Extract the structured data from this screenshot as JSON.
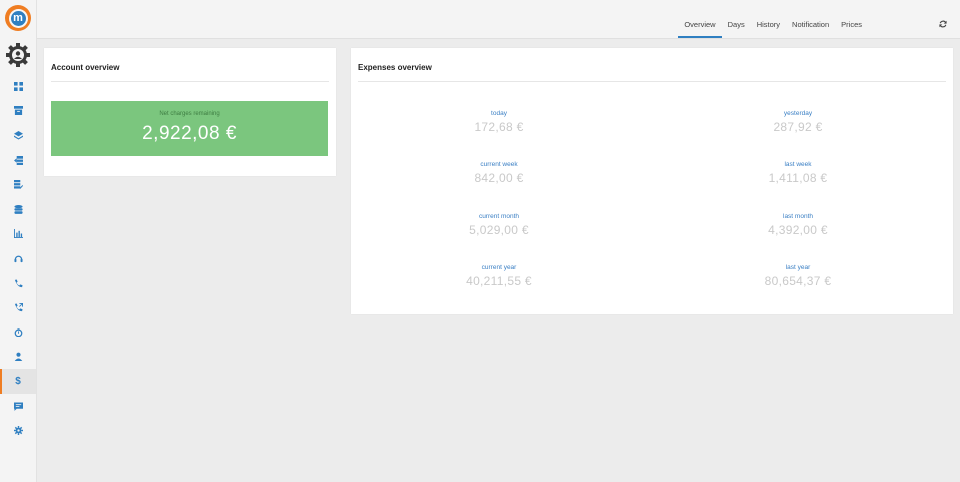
{
  "header": {
    "tabs": [
      {
        "label": "Overview",
        "active": true
      },
      {
        "label": "Days",
        "active": false
      },
      {
        "label": "History",
        "active": false
      },
      {
        "label": "Notification",
        "active": false
      },
      {
        "label": "Prices",
        "active": false
      }
    ],
    "refresh_icon": "refresh-icon"
  },
  "sidebar": {
    "logo_letter": "m",
    "items": [
      {
        "icon": "dashboard-icon"
      },
      {
        "icon": "archive-icon"
      },
      {
        "icon": "layers-icon"
      },
      {
        "icon": "import-icon"
      },
      {
        "icon": "database-edit-icon"
      },
      {
        "icon": "database-icon"
      },
      {
        "icon": "bar-chart-icon"
      },
      {
        "icon": "headset-icon"
      },
      {
        "icon": "phone-icon"
      },
      {
        "icon": "phone-forward-icon"
      },
      {
        "icon": "stopwatch-icon"
      },
      {
        "icon": "user-icon"
      },
      {
        "icon": "dollar-icon",
        "label": "$",
        "active": true
      },
      {
        "icon": "chat-icon"
      },
      {
        "icon": "gear-icon"
      }
    ]
  },
  "account": {
    "title": "Account overview",
    "label": "Net charges remaining",
    "value": "2,922,08 €"
  },
  "expenses": {
    "title": "Expenses overview",
    "today": {
      "label": "today",
      "value": "172,68 €"
    },
    "yesterday": {
      "label": "yesterday",
      "value": "287,92 €"
    },
    "current_week": {
      "label": "current week",
      "value": "842,00 €"
    },
    "last_week": {
      "label": "last week",
      "value": "1,411,08 €"
    },
    "current_month": {
      "label": "current month",
      "value": "5,029,00 €"
    },
    "last_month": {
      "label": "last month",
      "value": "4,392,00 €"
    },
    "current_year": {
      "label": "current year",
      "value": "40,211,55 €"
    },
    "last_year": {
      "label": "last year",
      "value": "80,654,37 €"
    }
  },
  "colors": {
    "accent": "#2f7fc1",
    "brand": "#ef7d22",
    "positive": "#7bc67e"
  }
}
